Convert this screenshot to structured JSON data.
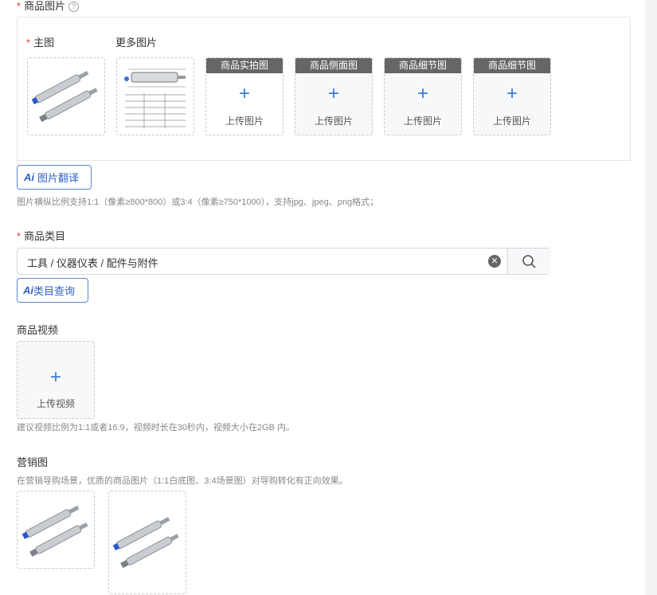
{
  "images_section": {
    "label": "商品图片",
    "main_label": "主图",
    "more_label": "更多图片",
    "slots": [
      {
        "tag": "商品实拍图",
        "upload": "上传图片"
      },
      {
        "tag": "商品侧面图",
        "upload": "上传图片"
      },
      {
        "tag": "商品细节图",
        "upload": "上传图片"
      },
      {
        "tag": "商品细节图",
        "upload": "上传图片"
      }
    ],
    "ai_translate": "图片翻译",
    "hint": "图片横纵比例支持1:1（像素≥800*800）或3:4（像素≥750*1000），支持jpg、jpeg、png格式；"
  },
  "category": {
    "label": "商品类目",
    "value": "工具 / 仪器仪表 / 配件与附件",
    "ai_query": "类目查询"
  },
  "video": {
    "label": "商品视频",
    "upload": "上传视频",
    "hint": "建议视频比例为1:1或者16:9，视频时长在30秒内，视频大小在2GB 内。"
  },
  "marketing": {
    "label": "营销图",
    "hint": "在营销导购场景，优质的商品图片（1:1白底图、3:4场景图）对导购转化有正向效果。"
  },
  "ai_glyph": "Ai",
  "colors": {
    "accent": "#2f62c7",
    "required": "#e4393c",
    "plus": "#3a7bd5"
  }
}
